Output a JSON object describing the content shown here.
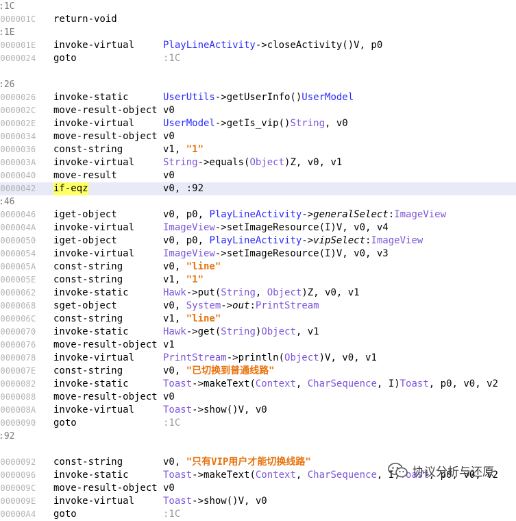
{
  "lines": [
    {
      "kind": "label",
      "text": ":1C"
    },
    {
      "kind": "instr",
      "addr": "0000001C",
      "op": "return-void",
      "args": []
    },
    {
      "kind": "label",
      "text": ":1E"
    },
    {
      "kind": "instr",
      "addr": "0000001E",
      "op": "invoke-virtual",
      "args": [
        {
          "c": "cls",
          "t": "PlayLineActivity"
        },
        {
          "t": "->closeActivity()V, p0"
        }
      ]
    },
    {
      "kind": "instr",
      "addr": "00000024",
      "op": "goto",
      "args": [
        {
          "c": "lbl",
          "t": ":1C"
        }
      ]
    },
    {
      "kind": "blank"
    },
    {
      "kind": "label",
      "text": ":26"
    },
    {
      "kind": "instr",
      "addr": "00000026",
      "op": "invoke-static",
      "args": [
        {
          "c": "cls",
          "t": "UserUtils"
        },
        {
          "t": "->getUserInfo()"
        },
        {
          "c": "cls",
          "t": "UserModel"
        }
      ]
    },
    {
      "kind": "instr",
      "addr": "0000002C",
      "op": "move-result-object",
      "args": [
        {
          "t": "v0"
        }
      ]
    },
    {
      "kind": "instr",
      "addr": "0000002E",
      "op": "invoke-virtual",
      "args": [
        {
          "c": "cls",
          "t": "UserModel"
        },
        {
          "t": "->getIs_vip()"
        },
        {
          "c": "typ",
          "t": "String"
        },
        {
          "t": ", v0"
        }
      ]
    },
    {
      "kind": "instr",
      "addr": "00000034",
      "op": "move-result-object",
      "args": [
        {
          "t": "v0"
        }
      ]
    },
    {
      "kind": "instr",
      "addr": "00000036",
      "op": "const-string",
      "args": [
        {
          "t": "v1, "
        },
        {
          "c": "str",
          "t": "\"1\""
        }
      ]
    },
    {
      "kind": "instr",
      "addr": "0000003A",
      "op": "invoke-virtual",
      "args": [
        {
          "c": "typ",
          "t": "String"
        },
        {
          "t": "->equals("
        },
        {
          "c": "typ",
          "t": "Object"
        },
        {
          "t": ")Z, v0, v1"
        }
      ]
    },
    {
      "kind": "instr",
      "addr": "00000040",
      "op": "move-result",
      "args": [
        {
          "t": "v0"
        }
      ]
    },
    {
      "kind": "instr",
      "addr": "00000042",
      "op": "if-eqz",
      "highlight": true,
      "args": [
        {
          "t": "v0, :92"
        }
      ]
    },
    {
      "kind": "label",
      "text": ":46"
    },
    {
      "kind": "instr",
      "addr": "00000046",
      "op": "iget-object",
      "args": [
        {
          "t": "v0, p0, "
        },
        {
          "c": "cls",
          "t": "PlayLineActivity"
        },
        {
          "t": "->"
        },
        {
          "c": "fld",
          "t": "generalSelect"
        },
        {
          "t": ":"
        },
        {
          "c": "typ",
          "t": "ImageView"
        }
      ]
    },
    {
      "kind": "instr",
      "addr": "0000004A",
      "op": "invoke-virtual",
      "args": [
        {
          "c": "typ",
          "t": "ImageView"
        },
        {
          "t": "->setImageResource(I)V, v0, v4"
        }
      ]
    },
    {
      "kind": "instr",
      "addr": "00000050",
      "op": "iget-object",
      "args": [
        {
          "t": "v0, p0, "
        },
        {
          "c": "cls",
          "t": "PlayLineActivity"
        },
        {
          "t": "->"
        },
        {
          "c": "fld",
          "t": "vipSelect"
        },
        {
          "t": ":"
        },
        {
          "c": "typ",
          "t": "ImageView"
        }
      ]
    },
    {
      "kind": "instr",
      "addr": "00000054",
      "op": "invoke-virtual",
      "args": [
        {
          "c": "typ",
          "t": "ImageView"
        },
        {
          "t": "->setImageResource(I)V, v0, v3"
        }
      ]
    },
    {
      "kind": "instr",
      "addr": "0000005A",
      "op": "const-string",
      "args": [
        {
          "t": "v0, "
        },
        {
          "c": "str",
          "t": "\"line\""
        }
      ]
    },
    {
      "kind": "instr",
      "addr": "0000005E",
      "op": "const-string",
      "args": [
        {
          "t": "v1, "
        },
        {
          "c": "str",
          "t": "\"1\""
        }
      ]
    },
    {
      "kind": "instr",
      "addr": "00000062",
      "op": "invoke-static",
      "args": [
        {
          "c": "typ",
          "t": "Hawk"
        },
        {
          "t": "->put("
        },
        {
          "c": "typ",
          "t": "String"
        },
        {
          "t": ", "
        },
        {
          "c": "typ",
          "t": "Object"
        },
        {
          "t": ")Z, v0, v1"
        }
      ]
    },
    {
      "kind": "instr",
      "addr": "00000068",
      "op": "sget-object",
      "args": [
        {
          "t": "v0, "
        },
        {
          "c": "typ",
          "t": "System"
        },
        {
          "t": "->"
        },
        {
          "c": "fld",
          "t": "out"
        },
        {
          "t": ":"
        },
        {
          "c": "typ",
          "t": "PrintStream"
        }
      ]
    },
    {
      "kind": "instr",
      "addr": "0000006C",
      "op": "const-string",
      "args": [
        {
          "t": "v1, "
        },
        {
          "c": "str",
          "t": "\"line\""
        }
      ]
    },
    {
      "kind": "instr",
      "addr": "00000070",
      "op": "invoke-static",
      "args": [
        {
          "c": "typ",
          "t": "Hawk"
        },
        {
          "t": "->get("
        },
        {
          "c": "typ",
          "t": "String"
        },
        {
          "t": ")"
        },
        {
          "c": "typ",
          "t": "Object"
        },
        {
          "t": ", v1"
        }
      ]
    },
    {
      "kind": "instr",
      "addr": "00000076",
      "op": "move-result-object",
      "args": [
        {
          "t": "v1"
        }
      ]
    },
    {
      "kind": "instr",
      "addr": "00000078",
      "op": "invoke-virtual",
      "args": [
        {
          "c": "typ",
          "t": "PrintStream"
        },
        {
          "t": "->println("
        },
        {
          "c": "typ",
          "t": "Object"
        },
        {
          "t": ")V, v0, v1"
        }
      ]
    },
    {
      "kind": "instr",
      "addr": "0000007E",
      "op": "const-string",
      "args": [
        {
          "t": "v0, "
        },
        {
          "c": "str",
          "t": "\"已切换到普通线路\""
        }
      ]
    },
    {
      "kind": "instr",
      "addr": "00000082",
      "op": "invoke-static",
      "args": [
        {
          "c": "typ",
          "t": "Toast"
        },
        {
          "t": "->makeText("
        },
        {
          "c": "typ",
          "t": "Context"
        },
        {
          "t": ", "
        },
        {
          "c": "typ",
          "t": "CharSequence"
        },
        {
          "t": ", I)"
        },
        {
          "c": "typ",
          "t": "Toast"
        },
        {
          "t": ", p0, v0, v2"
        }
      ]
    },
    {
      "kind": "instr",
      "addr": "00000088",
      "op": "move-result-object",
      "args": [
        {
          "t": "v0"
        }
      ]
    },
    {
      "kind": "instr",
      "addr": "0000008A",
      "op": "invoke-virtual",
      "args": [
        {
          "c": "typ",
          "t": "Toast"
        },
        {
          "t": "->show()V, v0"
        }
      ]
    },
    {
      "kind": "instr",
      "addr": "00000090",
      "op": "goto",
      "args": [
        {
          "c": "lbl",
          "t": ":1C"
        }
      ]
    },
    {
      "kind": "label",
      "text": ":92"
    },
    {
      "kind": "blank"
    },
    {
      "kind": "instr",
      "addr": "00000092",
      "op": "const-string",
      "args": [
        {
          "t": "v0, "
        },
        {
          "c": "str",
          "t": "\"只有VIP用户才能切换线路\""
        }
      ]
    },
    {
      "kind": "instr",
      "addr": "00000096",
      "op": "invoke-static",
      "args": [
        {
          "c": "typ",
          "t": "Toast"
        },
        {
          "t": "->makeText("
        },
        {
          "c": "typ",
          "t": "Context"
        },
        {
          "t": ", "
        },
        {
          "c": "typ",
          "t": "CharSequence"
        },
        {
          "t": ", I)"
        },
        {
          "c": "typ",
          "t": "Toast"
        },
        {
          "t": ", p0, v0, v2"
        }
      ]
    },
    {
      "kind": "instr",
      "addr": "0000009C",
      "op": "move-result-object",
      "args": [
        {
          "t": "v0"
        }
      ]
    },
    {
      "kind": "instr",
      "addr": "0000009E",
      "op": "invoke-virtual",
      "args": [
        {
          "c": "typ",
          "t": "Toast"
        },
        {
          "t": "->show()V, v0"
        }
      ]
    },
    {
      "kind": "instr",
      "addr": "000000A4",
      "op": "goto",
      "args": [
        {
          "c": "lbl",
          "t": ":1C"
        }
      ]
    }
  ],
  "watermark": {
    "text": "协议分析与还原",
    "icon": "wechat-icon"
  },
  "colors": {
    "class": "#2a2aff",
    "type": "#7d55d9",
    "string": "#e8720c",
    "label": "#9b9b9b",
    "address": "#b3b3b3",
    "highlight_row": "#e8eaf8",
    "highlight_opcode": "#ffff66"
  }
}
